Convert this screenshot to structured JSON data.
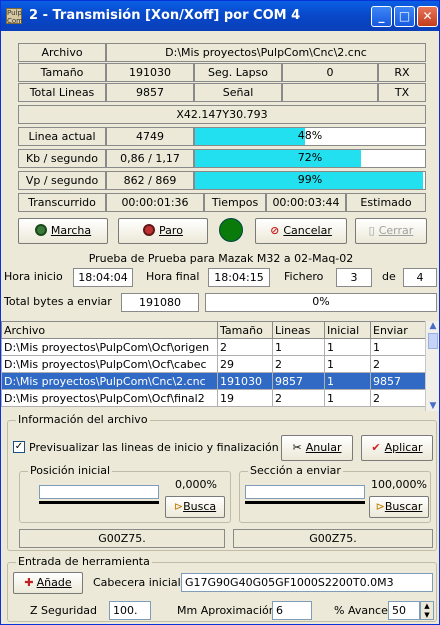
{
  "window": {
    "title": "2 -  Transmisión [Xon/Xoff] por COM 4",
    "icon_text": "Pulp Com"
  },
  "info": {
    "archivo_label": "Archivo",
    "archivo_value": "D:\\Mis proyectos\\PulpCom\\Cnc\\2.cnc",
    "tamano_label": "Tamaño",
    "tamano_value": "191030",
    "seg_lapso_label": "Seg. Lapso",
    "seg_lapso_value": "0",
    "rx_label": "RX",
    "total_lineas_label": "Total Lineas",
    "total_lineas_value": "9857",
    "senal_label": "Señal",
    "tx_label": "TX",
    "current_line": "X42.147Y30.793"
  },
  "progress": [
    {
      "label": "Linea actual",
      "value": "4749",
      "percent": 48,
      "percent_text": "48%"
    },
    {
      "label": "Kb / segundo",
      "value": "0,86 / 1,17",
      "percent": 72,
      "percent_text": "72%"
    },
    {
      "label": "Vp / segundo",
      "value": "862 / 869",
      "percent": 99,
      "percent_text": "99%"
    }
  ],
  "times": {
    "transcurrido_label": "Transcurrido",
    "transcurrido_value": "00:00:01:36",
    "tiempos_label": "Tiempos",
    "estimado_value": "00:00:03:44",
    "estimado_label": "Estimado"
  },
  "buttons": {
    "marcha": "Marcha",
    "paro": "Paro",
    "cancelar": "Cancelar",
    "cerrar": "Cerrar"
  },
  "status_color": "#0a7a0a",
  "job": {
    "title": "Prueba de Prueba para Mazak M32 a 02-Maq-02",
    "hora_inicio_label": "Hora inicio",
    "hora_inicio_value": "18:04:04",
    "hora_final_label": "Hora final",
    "hora_final_value": "18:04:15",
    "fichero_label": "Fichero",
    "fichero_value": "3",
    "de_label": "de",
    "de_value": "4"
  },
  "total_bytes": {
    "label": "Total bytes a enviar",
    "value": "191080",
    "percent": 0,
    "percent_text": "0%"
  },
  "files": {
    "columns": [
      "Archivo",
      "Tamaño",
      "Lineas",
      "Inicial",
      "Enviar"
    ],
    "rows": [
      [
        "D:\\Mis proyectos\\PulpCom\\Ocf\\origen",
        "2",
        "1",
        "1",
        "1"
      ],
      [
        "D:\\Mis proyectos\\PulpCom\\Ocf\\cabec",
        "29",
        "2",
        "1",
        "2"
      ],
      [
        "D:\\Mis proyectos\\PulpCom\\Cnc\\2.cnc",
        "191030",
        "9857",
        "1",
        "9857"
      ],
      [
        "D:\\Mis proyectos\\PulpCom\\Ocf\\final2",
        "19",
        "2",
        "1",
        "2"
      ]
    ],
    "selected_index": 2
  },
  "file_info": {
    "title": "Información del archivo",
    "preview_label": "Previsualizar las lineas de inicio y finalización",
    "preview_checked": true,
    "anular": "Anular",
    "aplicar": "Aplicar",
    "posicion_title": "Posición inicial",
    "posicion_value": "0,000%",
    "posicion_buscar": "Busca",
    "seccion_title": "Sección a enviar",
    "seccion_value": "100,000%",
    "seccion_buscar": "Buscar",
    "start_line": "G00Z75.",
    "end_line": "G00Z75."
  },
  "tool": {
    "title": "Entrada de herramienta",
    "anade": "Añade",
    "cabecera_label": "Cabecera inicial",
    "cabecera_value": "G17G90G40G05GF1000S2200T0.0M3",
    "zseg_label": "Z Seguridad",
    "zseg_value": "100.",
    "mm_label": "Mm Aproximación",
    "mm_value": "6",
    "avance_label": "% Avance",
    "avance_value": "50"
  }
}
